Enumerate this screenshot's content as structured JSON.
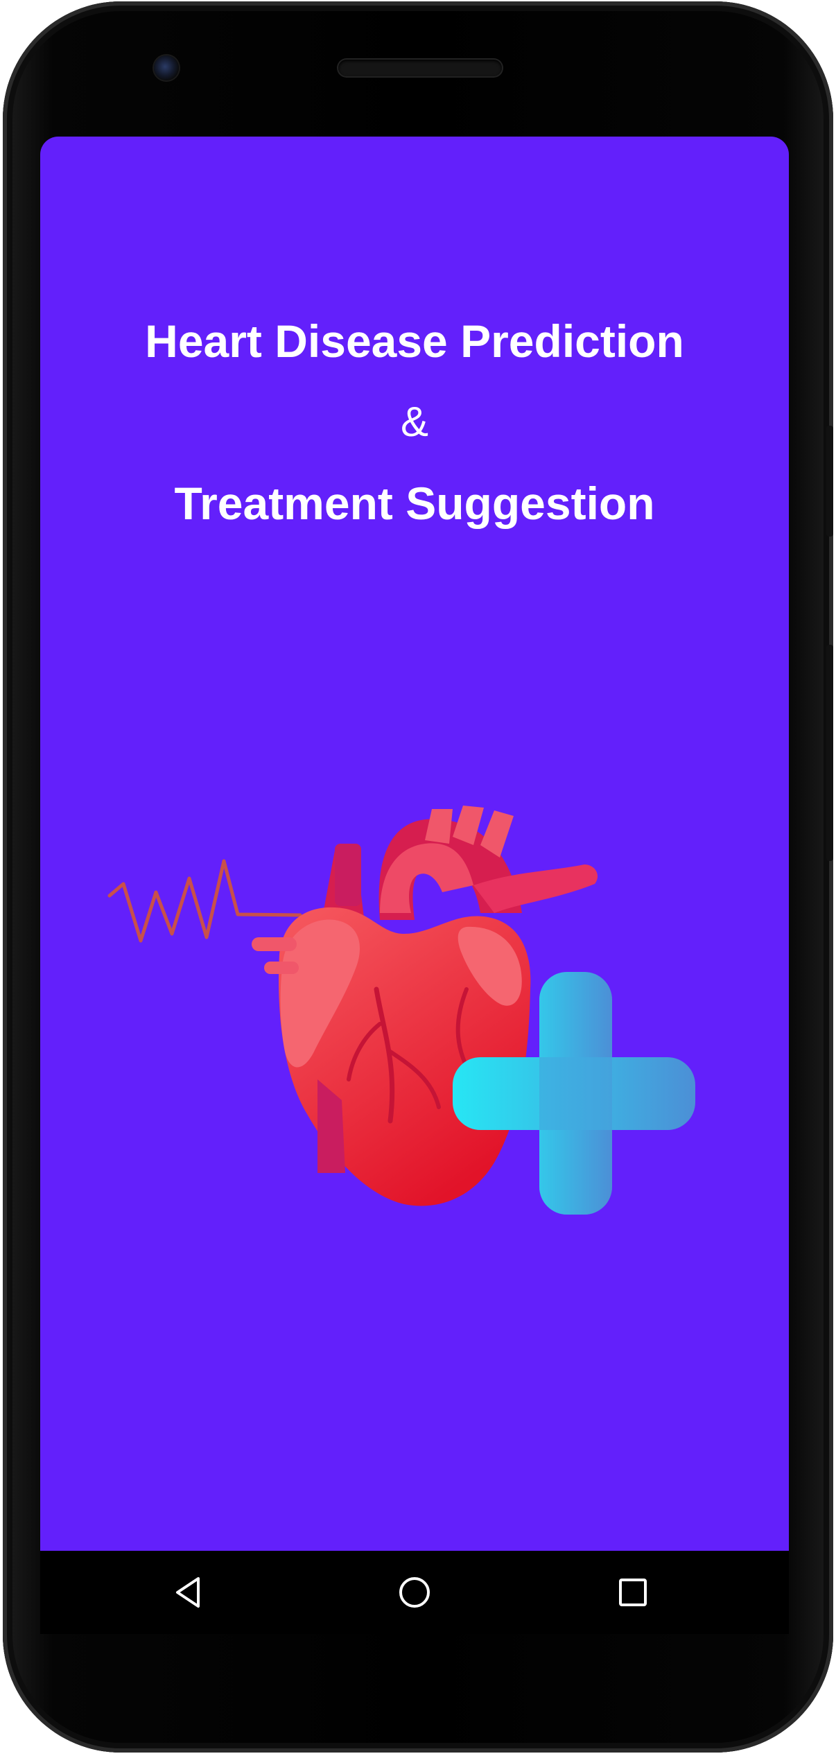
{
  "app": {
    "title_line1": "Heart Disease Prediction",
    "ampersand": "&",
    "title_line2": "Treatment Suggestion"
  },
  "colors": {
    "screen_background": "#6320fb",
    "title_text": "#ffffff",
    "heart_red": "#ee2438",
    "plus_gradient_start": "#27e6f4",
    "plus_gradient_end": "#4c8fd6",
    "pulse_line": "#c9504a"
  },
  "illustration": {
    "icons": [
      "pulse-line-icon",
      "heart-icon",
      "plus-cross-icon"
    ]
  },
  "navigation": {
    "back_icon": "triangle-back-icon",
    "home_icon": "circle-home-icon",
    "recents_icon": "square-recents-icon"
  }
}
